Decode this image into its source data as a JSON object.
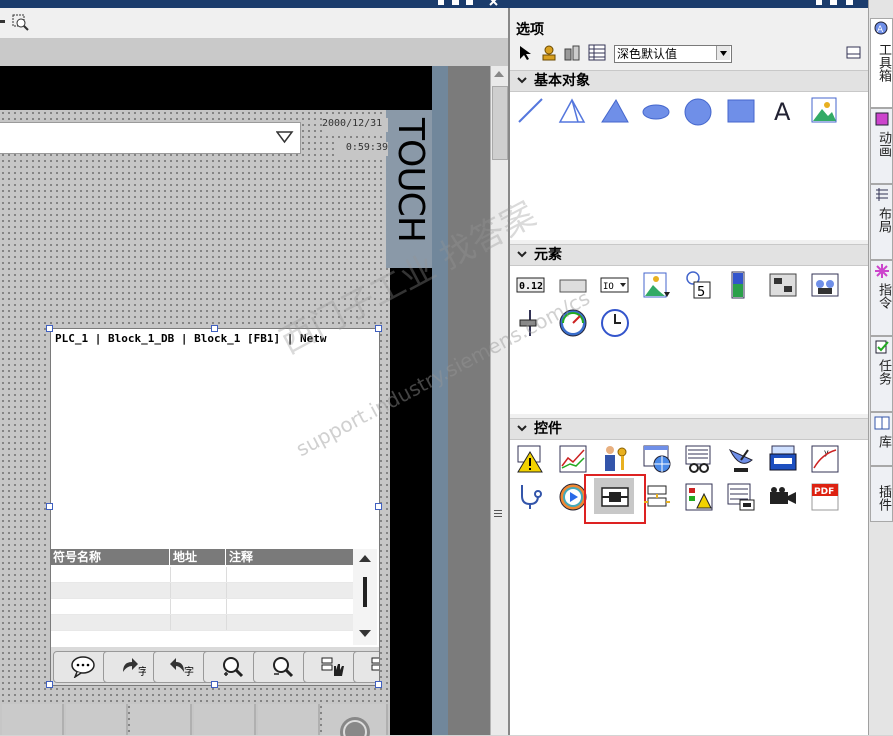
{
  "toolbox": {
    "title": "工具箱",
    "options_title": "选项",
    "style_select_value": "深色默认值",
    "sections": {
      "basic": "基本对象",
      "elements": "元素",
      "controls": "控件"
    },
    "text_tool_glyph": "A",
    "pdf_label": "PDF"
  },
  "screen": {
    "date": "2000/12/31",
    "time": "0:59:39",
    "logo_text": "TOUCH",
    "plc_path": "PLC_1 | Block_1_DB | Block_1 [FB1] | Netw",
    "symbol_table": {
      "columns": [
        "符号名称",
        "地址",
        "注释"
      ],
      "rows": [
        [
          "",
          "",
          ""
        ],
        [
          "",
          "",
          ""
        ],
        [
          "",
          "",
          ""
        ],
        [
          "",
          "",
          ""
        ]
      ]
    }
  },
  "vertical_tabs": [
    "工具箱",
    "动画",
    "布局",
    "指令",
    "任务",
    "库",
    "插件"
  ],
  "watermark": {
    "cn": "西门子工业  找答案",
    "url": "support.industry.siemens.com/cs"
  },
  "colors": {
    "selection_border": "#d22222",
    "titlebar": "#1b3c6c",
    "tool_blue": "#6f8fe8"
  }
}
